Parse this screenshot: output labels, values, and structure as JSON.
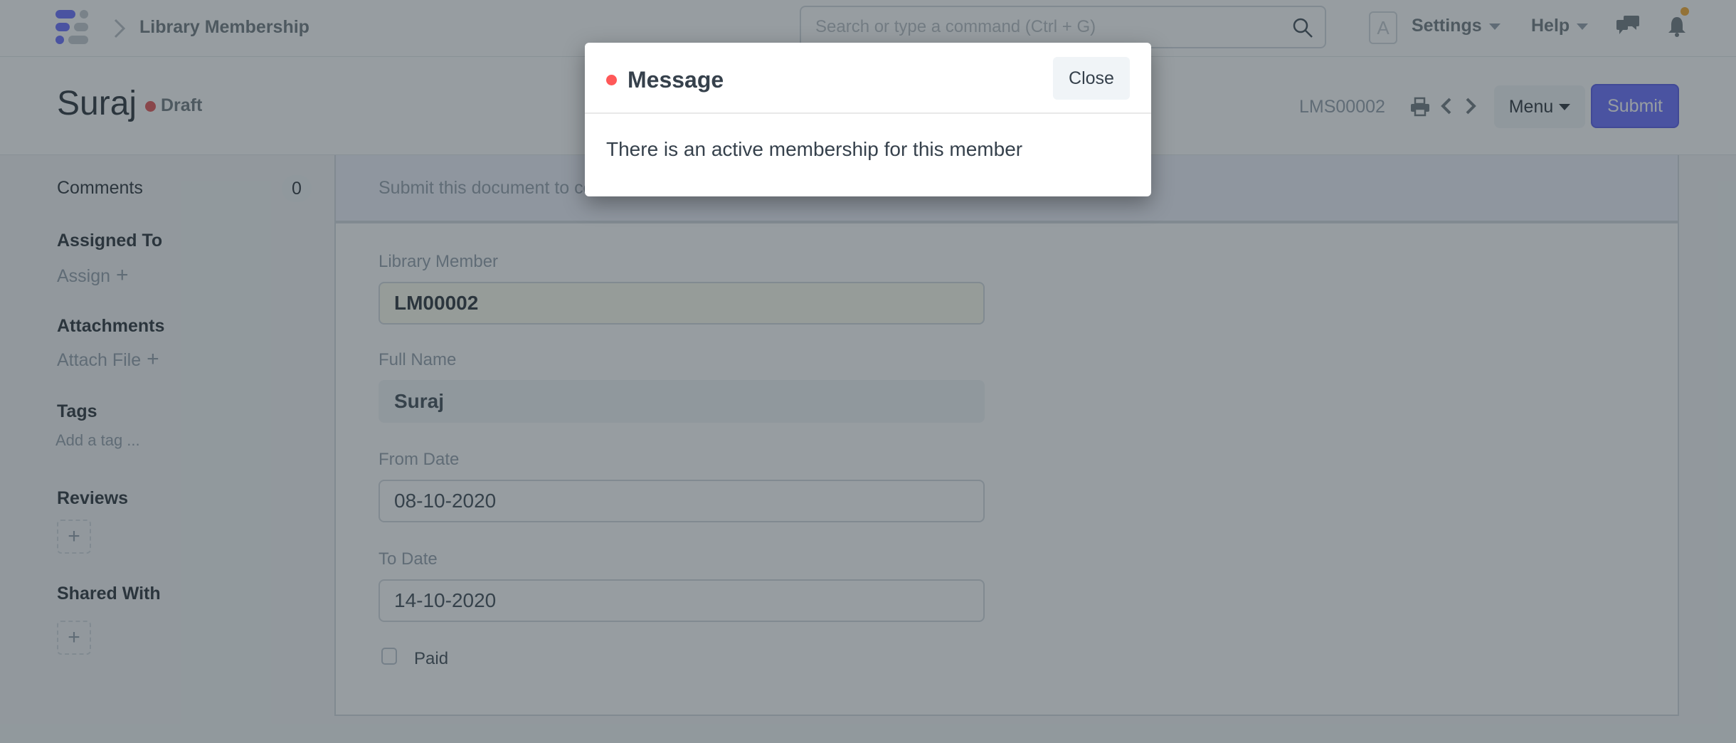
{
  "navbar": {
    "breadcrumb": "Library Membership",
    "search_placeholder": "Search or type a command (Ctrl + G)",
    "avatar_letter": "A",
    "settings_label": "Settings",
    "help_label": "Help",
    "icons": [
      "app-logo-icon",
      "chevron-right-icon",
      "search-icon",
      "chat-icon",
      "bell-icon"
    ],
    "notification_dot_color": "#f6a623"
  },
  "page_head": {
    "title": "Suraj",
    "status": "Draft",
    "status_color": "#e24c4c",
    "doc_id": "LMS00002",
    "menu_label": "Menu",
    "submit_label": "Submit",
    "accent_color": "#5e64ff"
  },
  "sidebar": {
    "comments_label": "Comments",
    "comments_count": "0",
    "assigned_heading": "Assigned To",
    "assign_label": "Assign",
    "attachments_heading": "Attachments",
    "attach_label": "Attach File",
    "tags_heading": "Tags",
    "tag_placeholder": "Add a tag ...",
    "reviews_heading": "Reviews",
    "shared_heading": "Shared With",
    "plus": "+"
  },
  "form": {
    "message": "Submit this document to confirm",
    "fields": [
      {
        "label": "Library Member",
        "value": "LM00002"
      },
      {
        "label": "Full Name",
        "value": "Suraj"
      },
      {
        "label": "From Date",
        "value": "08-10-2020"
      },
      {
        "label": "To Date",
        "value": "14-10-2020"
      }
    ],
    "paid_label": "Paid",
    "paid_checked": false
  },
  "modal": {
    "title": "Message",
    "close_label": "Close",
    "body": "There is an active membership for this member",
    "indicator_color": "#ff5858"
  }
}
